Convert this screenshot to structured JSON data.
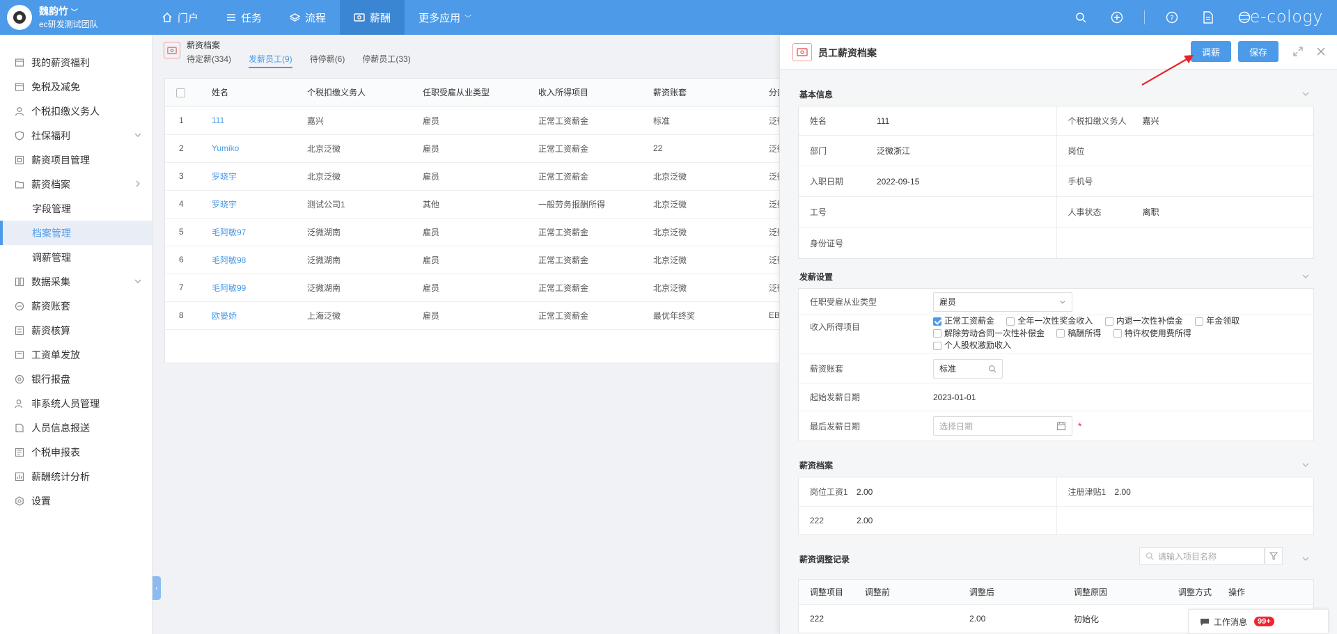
{
  "header": {
    "user_name": "魏韵竹",
    "team": "ec研发测试团队",
    "nav": [
      "门户",
      "任务",
      "流程",
      "薪酬",
      "更多应用"
    ],
    "brand": "e-cology"
  },
  "sidebar": {
    "items": [
      {
        "label": "我的薪资福利",
        "icon": "wallet-icon"
      },
      {
        "label": "免税及减免",
        "icon": "wallet-icon"
      },
      {
        "label": "个税扣缴义务人",
        "icon": "user-icon"
      },
      {
        "label": "社保福利",
        "icon": "shield-icon"
      },
      {
        "label": "薪资项目管理",
        "icon": "project-icon"
      },
      {
        "label": "薪资档案",
        "icon": "folder-icon"
      },
      {
        "label": "字段管理"
      },
      {
        "label": "档案管理"
      },
      {
        "label": "调薪管理"
      },
      {
        "label": "数据采集",
        "icon": "data-icon"
      },
      {
        "label": "薪资账套",
        "icon": "ledger-icon"
      },
      {
        "label": "薪资核算",
        "icon": "calc-icon"
      },
      {
        "label": "工资单发放",
        "icon": "send-icon"
      },
      {
        "label": "银行报盘",
        "icon": "bank-icon"
      },
      {
        "label": "非系统人员管理",
        "icon": "person-gear-icon"
      },
      {
        "label": "人员信息报送",
        "icon": "report-icon"
      },
      {
        "label": "个税申报表",
        "icon": "tax-icon"
      },
      {
        "label": "薪酬统计分析",
        "icon": "stats-icon"
      },
      {
        "label": "设置",
        "icon": "gear-icon"
      }
    ]
  },
  "list": {
    "title": "薪资档案",
    "tabs": [
      "待定薪(334)",
      "发薪员工(9)",
      "待停薪(6)",
      "停薪员工(33)"
    ],
    "columns": [
      "姓名",
      "个税扣缴义务人",
      "任职受雇从业类型",
      "收入所得项目",
      "薪资账套",
      "分部"
    ],
    "rows": [
      {
        "no": "1",
        "name": "111",
        "withholder": "嘉兴",
        "type": "雇员",
        "income": "正常工资薪金",
        "ledger": "标准",
        "branch": "泛微"
      },
      {
        "no": "2",
        "name": "Yumiko",
        "withholder": "北京泛微",
        "type": "雇员",
        "income": "正常工资薪金",
        "ledger": "22",
        "branch": "泛微"
      },
      {
        "no": "3",
        "name": "罗晓宇",
        "withholder": "北京泛微",
        "type": "雇员",
        "income": "正常工资薪金",
        "ledger": "北京泛微",
        "branch": "泛微"
      },
      {
        "no": "4",
        "name": "罗晓宇",
        "withholder": "测试公司1",
        "type": "其他",
        "income": "一般劳务报酬所得",
        "ledger": "北京泛微",
        "branch": "泛微"
      },
      {
        "no": "5",
        "name": "毛阿敏97",
        "withholder": "泛微湖南",
        "type": "雇员",
        "income": "正常工资薪金",
        "ledger": "北京泛微",
        "branch": "泛微"
      },
      {
        "no": "6",
        "name": "毛阿敏98",
        "withholder": "泛微湖南",
        "type": "雇员",
        "income": "正常工资薪金",
        "ledger": "北京泛微",
        "branch": "泛微"
      },
      {
        "no": "7",
        "name": "毛阿敏99",
        "withholder": "泛微湖南",
        "type": "雇员",
        "income": "正常工资薪金",
        "ledger": "北京泛微",
        "branch": "泛微"
      },
      {
        "no": "8",
        "name": "欧晏娇",
        "withholder": "上海泛微",
        "type": "雇员",
        "income": "正常工资薪金",
        "ledger": "最优年终奖",
        "branch": "EB"
      }
    ]
  },
  "drawer": {
    "title": "员工薪资档案",
    "adjust_label": "调薪",
    "save_label": "保存",
    "basic": {
      "title": "基本信息",
      "name_label": "姓名",
      "name": "111",
      "withholder_label": "个税扣缴义务人",
      "withholder": "嘉兴",
      "dept_label": "部门",
      "dept": "泛微浙江",
      "post_label": "岗位",
      "post": "",
      "hire_label": "入职日期",
      "hire": "2022-09-15",
      "phone_label": "手机号",
      "phone": "",
      "empno_label": "工号",
      "empno": "",
      "status_label": "人事状态",
      "status": "离职",
      "id_label": "身份证号",
      "id": ""
    },
    "pay": {
      "title": "发薪设置",
      "type_label": "任职受雇从业类型",
      "type": "雇员",
      "income_label": "收入所得项目",
      "income_options": [
        {
          "label": "正常工资薪金",
          "checked": true
        },
        {
          "label": "全年一次性奖金收入",
          "checked": false
        },
        {
          "label": "内退一次性补偿金",
          "checked": false
        },
        {
          "label": "年金领取",
          "checked": false
        },
        {
          "label": "解除劳动合同一次性补偿金",
          "checked": false
        },
        {
          "label": "稿酬所得",
          "checked": false
        },
        {
          "label": "特许权使用费所得",
          "checked": false
        },
        {
          "label": "个人股权激励收入",
          "checked": false
        }
      ],
      "ledger_label": "薪资账套",
      "ledger": "标准",
      "start_label": "起始发薪日期",
      "start": "2023-01-01",
      "end_label": "最后发薪日期",
      "end_placeholder": "选择日期"
    },
    "archive": {
      "title": "薪资档案",
      "items": [
        {
          "label": "岗位工资1",
          "value": "2.00"
        },
        {
          "label": "注册津贴1",
          "value": "2.00"
        },
        {
          "label": "222",
          "value": "2.00"
        }
      ]
    },
    "records": {
      "title": "薪资调整记录",
      "search_placeholder": "请输入项目名称",
      "columns": [
        "调整项目",
        "调整前",
        "调整后",
        "调整原因",
        "调整方式",
        "操作"
      ],
      "rows": [
        {
          "item": "222",
          "before": "",
          "after": "2.00",
          "reason": "初始化",
          "method": "",
          "op": ""
        }
      ]
    }
  },
  "work_msg": {
    "label": "工作消息",
    "badge": "99+"
  },
  "colors": {
    "primary": "#4d9ae8",
    "danger": "#f5222d",
    "annotation_arrow": "#e8232a"
  }
}
